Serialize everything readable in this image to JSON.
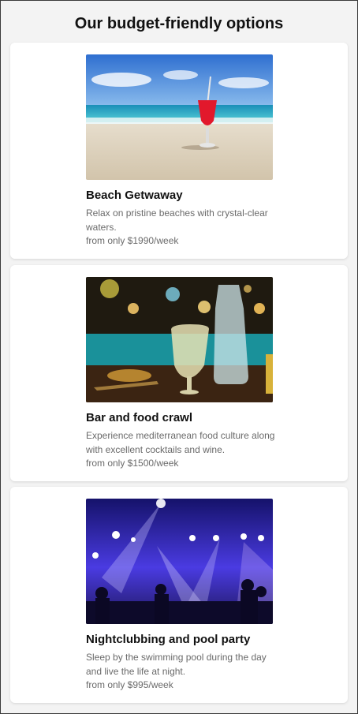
{
  "page": {
    "title": "Our budget-friendly options"
  },
  "options": [
    {
      "title": "Beach Getwaway",
      "description": "Relax on pristine beaches with crystal-clear waters.",
      "price": "from only $1990/week"
    },
    {
      "title": "Bar and food crawl",
      "description": "Experience mediterranean food culture along with excellent cocktails and wine.",
      "price": "from only $1500/week"
    },
    {
      "title": "Nightclubbing and pool party",
      "description": "Sleep by the swimming pool during the day and live the life at night.",
      "price": "from only $995/week"
    }
  ]
}
